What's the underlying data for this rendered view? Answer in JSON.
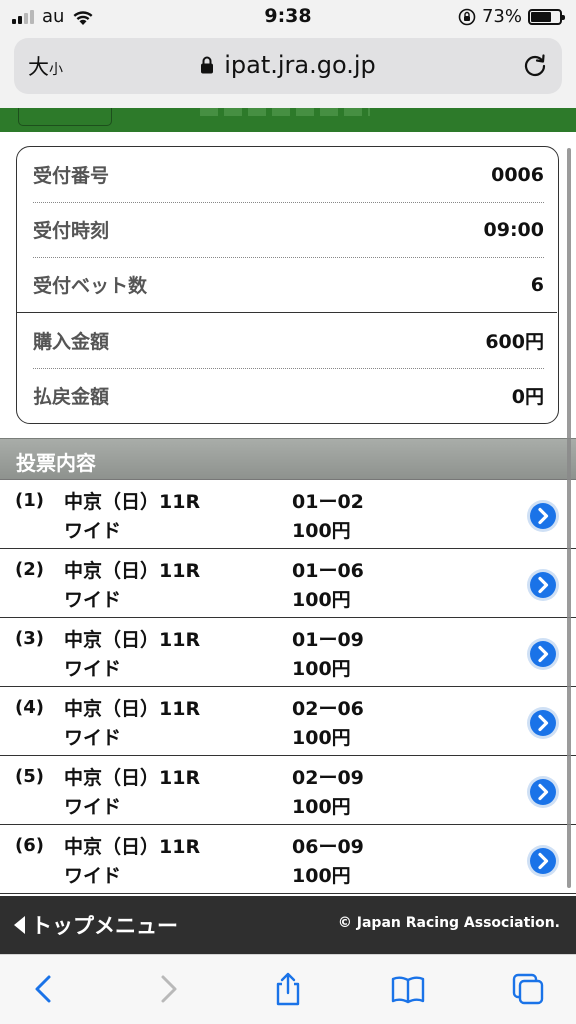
{
  "status_bar": {
    "carrier": "au",
    "time": "9:38",
    "battery": "73%",
    "battery_level": 0.73
  },
  "address_bar": {
    "text_size_large": "大",
    "text_size_small": "小",
    "url": "ipat.jra.go.jp"
  },
  "summary": {
    "rows": [
      {
        "label": "受付番号",
        "value": "0006"
      },
      {
        "label": "受付時刻",
        "value": "09:00"
      },
      {
        "label": "受付ベット数",
        "value": "6"
      },
      {
        "label": "購入金額",
        "value": "600円"
      },
      {
        "label": "払戻金額",
        "value": "0円"
      }
    ]
  },
  "section": {
    "title": "投票内容"
  },
  "bets": [
    {
      "num": "(1)",
      "race": "中京（日）11R",
      "type": "ワイド",
      "combo": "01ー02",
      "amount": "100円"
    },
    {
      "num": "(2)",
      "race": "中京（日）11R",
      "type": "ワイド",
      "combo": "01ー06",
      "amount": "100円"
    },
    {
      "num": "(3)",
      "race": "中京（日）11R",
      "type": "ワイド",
      "combo": "01ー09",
      "amount": "100円"
    },
    {
      "num": "(4)",
      "race": "中京（日）11R",
      "type": "ワイド",
      "combo": "02ー06",
      "amount": "100円"
    },
    {
      "num": "(5)",
      "race": "中京（日）11R",
      "type": "ワイド",
      "combo": "02ー09",
      "amount": "100円"
    },
    {
      "num": "(6)",
      "race": "中京（日）11R",
      "type": "ワイド",
      "combo": "06ー09",
      "amount": "100円"
    }
  ],
  "footer": {
    "top_menu": "トップメニュー",
    "copyright": "© Japan Racing Association."
  },
  "icons": {
    "accent": "#2d7a2a",
    "link_blue": "#1a73e8"
  }
}
